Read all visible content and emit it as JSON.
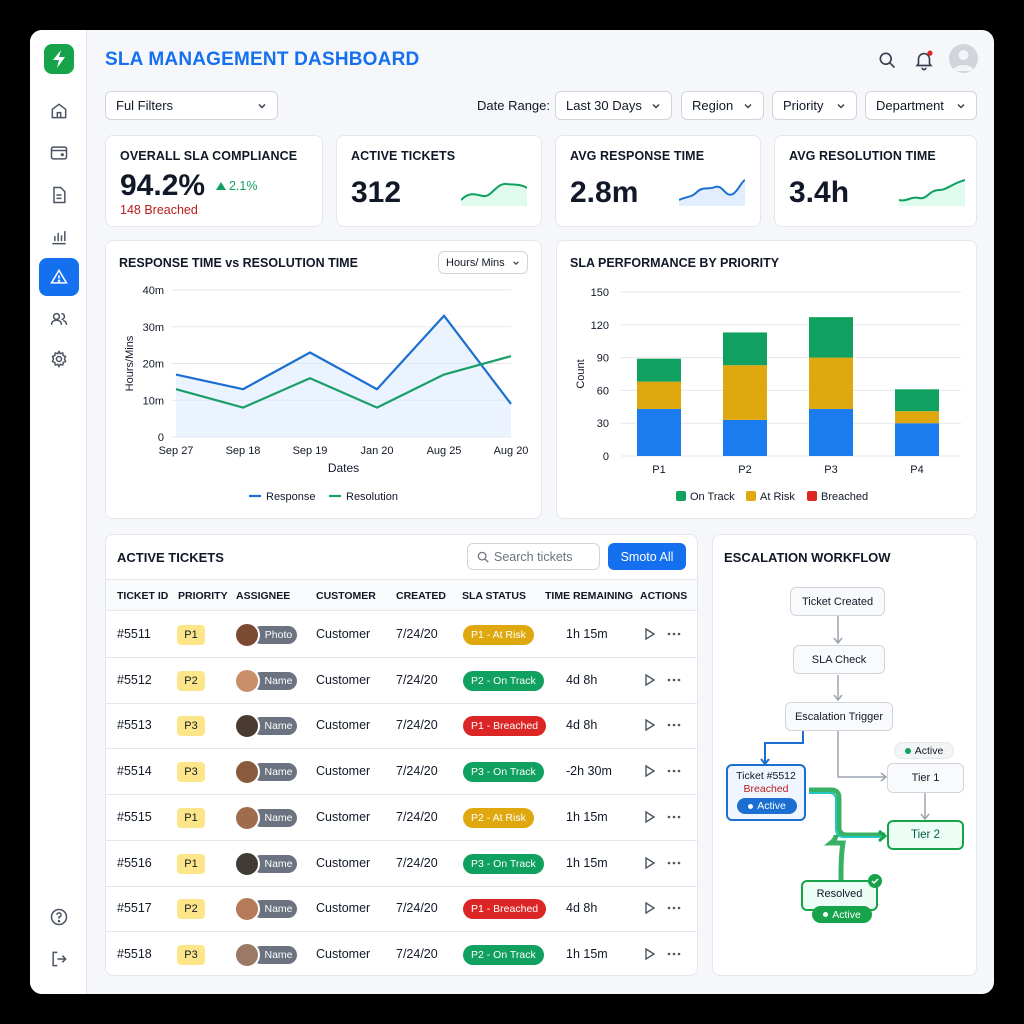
{
  "header": {
    "title": "SLA MANAGEMENT DASHBOARD"
  },
  "filters": {
    "full_filters": "Ful Filters",
    "date_range_label": "Date Range:",
    "date_range": "Last 30 Days",
    "region": "Region",
    "priority": "Priority",
    "department": "Department"
  },
  "kpis": [
    {
      "title": "OVERALL SLA COMPLIANCE",
      "value": "94.2%",
      "delta": "2.1%",
      "sub": "148 Breached"
    },
    {
      "title": "ACTIVE TICKETS",
      "value": "312"
    },
    {
      "title": "AVG RESPONSE TIME",
      "value": "2.8m"
    },
    {
      "title": "AVG RESOLUTION TIME",
      "value": "3.4h"
    }
  ],
  "colors": {
    "accent": "#1570ef",
    "on_track": "#10a05f",
    "at_risk": "#e0a80f",
    "breached": "#dc2626",
    "response": "#1b6fd0",
    "resolution": "#1a9e6a"
  },
  "line_chart": {
    "title": "RESPONSE TIME vs RESOLUTION TIME",
    "unit_select": "Hours/ Mins",
    "chart_data": {
      "type": "line",
      "x": [
        "Sep 27",
        "Sep 18",
        "Sep 19",
        "Jan 20",
        "Aug 25",
        "Aug 20"
      ],
      "series": [
        {
          "name": "Response",
          "values": [
            17,
            13,
            23,
            13,
            33,
            9
          ]
        },
        {
          "name": "Resolution",
          "values": [
            13,
            8,
            16,
            8,
            17,
            22
          ]
        }
      ],
      "xlabel": "Dates",
      "ylabel": "Hours/Mins",
      "y_ticks": [
        "0",
        "10m",
        "20m",
        "30m",
        "40m"
      ],
      "ylim": [
        0,
        40
      ],
      "grid": true,
      "legend": "bottom"
    }
  },
  "bar_chart": {
    "title": "SLA PERFORMANCE BY PRIORITY",
    "chart_data": {
      "type": "bar",
      "stacked": true,
      "categories": [
        "P1",
        "P2",
        "P3",
        "P4"
      ],
      "series": [
        {
          "name": "On Track",
          "values": [
            43,
            33,
            43,
            30
          ]
        },
        {
          "name": "At Risk",
          "values": [
            25,
            50,
            47,
            11
          ]
        },
        {
          "name": "Breached",
          "values": [
            21,
            30,
            37,
            20
          ]
        }
      ],
      "series_color_order": [
        "#1b7cf0",
        "#e0a80f",
        "#10a05f"
      ],
      "ylabel": "Count",
      "y_ticks": [
        "0",
        "30",
        "60",
        "90",
        "120",
        "150"
      ],
      "ylim": [
        0,
        150
      ],
      "grid": true,
      "legend": "bottom",
      "legend_items": [
        {
          "name": "On Track",
          "color": "#10a05f"
        },
        {
          "name": "At Risk",
          "color": "#e0a80f"
        },
        {
          "name": "Breached",
          "color": "#dc2626"
        }
      ]
    }
  },
  "tickets": {
    "title": "ACTIVE TICKETS",
    "search_placeholder": "Search tickets",
    "button": "Smoto All",
    "columns": [
      "TICKET ID",
      "PRIORITY",
      "ASSIGNEE",
      "CUSTOMER",
      "CREATED",
      "SLA STATUS",
      "TIME REMAINING",
      "ACTIONS"
    ],
    "rows": [
      {
        "id": "#5511",
        "priority": "P1",
        "assignee": "Photo",
        "customer": "Customer",
        "created": "7/24/20",
        "status": "P1 - At Risk",
        "status_color": "#e0a80f",
        "remaining": "1h 15m"
      },
      {
        "id": "#5512",
        "priority": "P2",
        "assignee": "Name",
        "customer": "Customer",
        "created": "7/24/20",
        "status": "P2 - On Track",
        "status_color": "#10a05f",
        "remaining": "4d 8h"
      },
      {
        "id": "#5513",
        "priority": "P3",
        "assignee": "Name",
        "customer": "Customer",
        "created": "7/24/20",
        "status": "P1 - Breached",
        "status_color": "#dc2626",
        "remaining": "4d 8h"
      },
      {
        "id": "#5514",
        "priority": "P3",
        "assignee": "Name",
        "customer": "Customer",
        "created": "7/24/20",
        "status": "P3 - On Track",
        "status_color": "#10a05f",
        "remaining": "-2h 30m"
      },
      {
        "id": "#5515",
        "priority": "P1",
        "assignee": "Name",
        "customer": "Customer",
        "created": "7/24/20",
        "status": "P2 - At Risk",
        "status_color": "#e0a80f",
        "remaining": "1h 15m"
      },
      {
        "id": "#5516",
        "priority": "P1",
        "assignee": "Name",
        "customer": "Customer",
        "created": "7/24/20",
        "status": "P3 - On Track",
        "status_color": "#10a05f",
        "remaining": "1h 15m"
      },
      {
        "id": "#5517",
        "priority": "P2",
        "assignee": "Name",
        "customer": "Customer",
        "created": "7/24/20",
        "status": "P1 - Breached",
        "status_color": "#dc2626",
        "remaining": "4d 8h"
      },
      {
        "id": "#5518",
        "priority": "P3",
        "assignee": "Name",
        "customer": "Customer",
        "created": "7/24/20",
        "status": "P2 - On Track",
        "status_color": "#10a05f",
        "remaining": "1h 15m"
      }
    ]
  },
  "workflow": {
    "title": "ESCALATION WORKFLOW",
    "nodes": {
      "created": "Ticket Created",
      "check": "SLA Check",
      "trigger": "Escalation Trigger",
      "ticket": "Ticket #5512",
      "ticket_status": "Breached",
      "ticket_badge": "Active",
      "tier1_badge": "Active",
      "tier1": "Tier 1",
      "tier2": "Tier 2",
      "resolved": "Resolved",
      "resolved_badge": "Active"
    }
  }
}
